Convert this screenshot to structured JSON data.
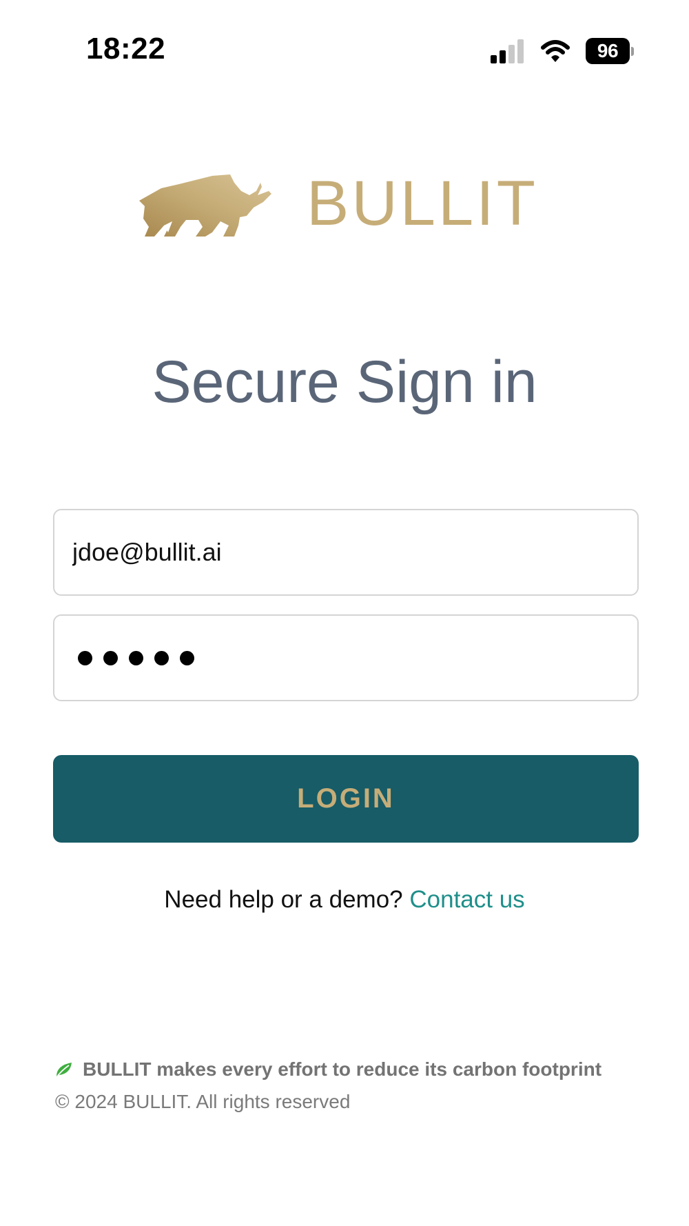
{
  "status_bar": {
    "time": "18:22",
    "battery_level": "96",
    "icons": [
      "signal-icon",
      "wifi-icon",
      "battery-icon"
    ]
  },
  "brand": {
    "name": "BULLIT",
    "logo_icon": "bull-icon",
    "gold_color": "#c6ad78"
  },
  "page": {
    "title": "Secure Sign in"
  },
  "form": {
    "email_value": "jdoe@bullit.ai",
    "password_masked_length": 5,
    "login_label": "LOGIN",
    "button_color": "#175c67"
  },
  "help": {
    "prompt": "Need help or a demo?",
    "contact_label": "Contact us",
    "link_color": "#1f8f8a"
  },
  "footer": {
    "carbon_icon": "leaf-icon",
    "carbon_text": "BULLIT makes every effort to reduce its carbon footprint",
    "copyright": "© 2024 BULLIT. All rights reserved"
  }
}
